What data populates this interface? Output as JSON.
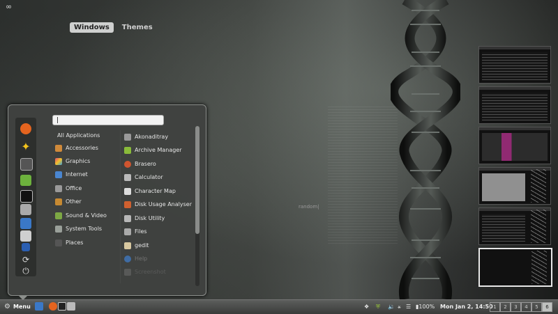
{
  "expo_tabs": [
    {
      "label": "Windows",
      "active": true
    },
    {
      "label": "Themes",
      "active": false
    }
  ],
  "wallpaper": {
    "random_text": "random|"
  },
  "menu": {
    "search": {
      "placeholder": "",
      "value": ""
    },
    "favorites": [
      {
        "icon": "firefox-icon",
        "color": "#e4641f"
      },
      {
        "icon": "star-icon",
        "color": "#f3c31c"
      },
      {
        "icon": "settings-icon",
        "color": "#8e9a8e"
      },
      {
        "icon": "green-app-icon",
        "color": "#6db23d"
      },
      {
        "icon": "terminal-icon",
        "color": "#222"
      },
      {
        "icon": "files-icon",
        "color": "#aaa"
      },
      {
        "icon": "image-viewer-icon",
        "color": "#3a78c7"
      },
      {
        "icon": "monitor-icon",
        "color": "#cfcfcf"
      },
      {
        "icon": "lock-icon",
        "color": "#2b5fb2"
      },
      {
        "icon": "refresh-icon",
        "color": "#ddd"
      },
      {
        "icon": "power-icon",
        "color": "#ddd"
      }
    ],
    "categories": [
      {
        "label": "All Applications",
        "icon": "none",
        "color": ""
      },
      {
        "label": "Accessories",
        "icon": "accessories-icon",
        "color": "#d08a3a"
      },
      {
        "label": "Graphics",
        "icon": "graphics-icon",
        "color": "#e04a6b"
      },
      {
        "label": "Internet",
        "icon": "internet-icon",
        "color": "#4a86d0"
      },
      {
        "label": "Office",
        "icon": "office-icon",
        "color": "#9a9a9a"
      },
      {
        "label": "Other",
        "icon": "other-icon",
        "color": "#c78a32"
      },
      {
        "label": "Sound & Video",
        "icon": "sound-video-icon",
        "color": "#7da844"
      },
      {
        "label": "System Tools",
        "icon": "system-tools-icon",
        "color": "#9aa09a"
      },
      {
        "label": "Places",
        "icon": "places-icon",
        "color": "#555"
      }
    ],
    "apps": [
      {
        "label": "Akonaditray",
        "icon": "akonadi-icon",
        "color": "#9a9a9a"
      },
      {
        "label": "Archive Manager",
        "icon": "archive-icon",
        "color": "#8abc3a"
      },
      {
        "label": "Brasero",
        "icon": "brasero-icon",
        "color": "#d0552f"
      },
      {
        "label": "Calculator",
        "icon": "calculator-icon",
        "color": "#bbbbbb"
      },
      {
        "label": "Character Map",
        "icon": "character-map-icon",
        "color": "#dddddd"
      },
      {
        "label": "Disk Usage Analyser",
        "icon": "disk-usage-icon",
        "color": "#d0602f"
      },
      {
        "label": "Disk Utility",
        "icon": "disk-utility-icon",
        "color": "#b8b8b8"
      },
      {
        "label": "Files",
        "icon": "files-icon",
        "color": "#aaaaaa"
      },
      {
        "label": "gedit",
        "icon": "gedit-icon",
        "color": "#d8c8a0"
      },
      {
        "label": "Help",
        "icon": "help-icon",
        "color": "#3f7fd0"
      },
      {
        "label": "Screenshot",
        "icon": "screenshot-icon",
        "color": "#888888"
      }
    ]
  },
  "panel": {
    "menu_label": "Menu",
    "launchers": [
      {
        "icon": "show-desktop-icon",
        "color": "#3a78c7"
      },
      {
        "icon": "firefox-icon",
        "color": "#e4641f"
      },
      {
        "icon": "terminal-icon",
        "color": "#222"
      },
      {
        "icon": "files-icon",
        "color": "#bbb"
      }
    ],
    "tray": [
      {
        "icon": "dropbox-icon"
      },
      {
        "icon": "shield-icon"
      },
      {
        "icon": "volume-icon"
      },
      {
        "icon": "bluetooth-icon"
      },
      {
        "icon": "wifi-icon"
      }
    ],
    "battery": "100%",
    "clock": "Mon Jan  2, 14:50",
    "workspaces": [
      "1",
      "2",
      "3",
      "4",
      "5",
      "6"
    ],
    "active_workspace": "6"
  }
}
